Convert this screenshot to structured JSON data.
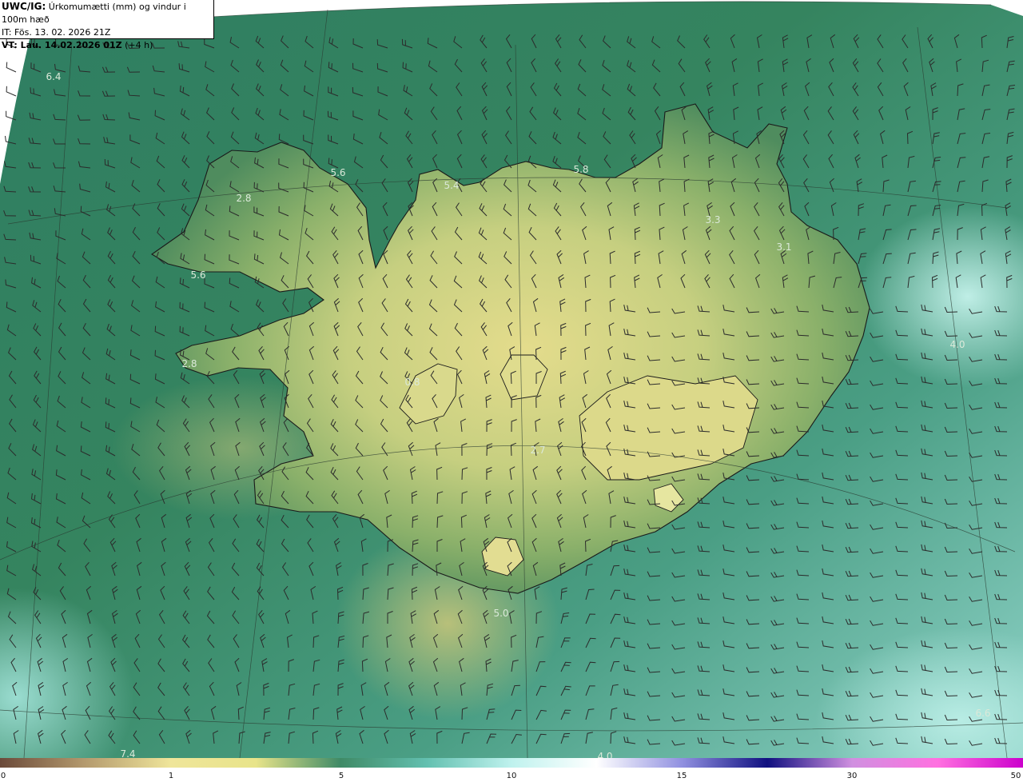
{
  "header": {
    "title_code": "UWC/IG:",
    "title_text": " Úrkomumætti (mm) og vindur i 100m hæð",
    "issue_time": "IT: Fös. 13. 02. 2026 21Z",
    "valid_label": "VT: Lau. 14.02.2026 01Z",
    "valid_suffix": " (+4 h)"
  },
  "colorbar": {
    "ticks": [
      "0",
      "1",
      "5",
      "10",
      "15",
      "30",
      "50"
    ],
    "colors": [
      "#6b4a3a",
      "#b49a6e",
      "#efe59a",
      "#e8e48a",
      "#3f8a66",
      "#63c0b0",
      "#bff2ee",
      "#ffffff",
      "#9090e0",
      "#101080",
      "#d090e0",
      "#ff70e0",
      "#cc00cc"
    ]
  },
  "map_values": [
    "6.4",
    "5.6",
    "2.8",
    "5.4",
    "5.8",
    "3.3",
    "3.1",
    "5.6",
    "2.8",
    "0.8",
    "2.7",
    "4.0",
    "5.0",
    "6.6",
    "7.4",
    "4.0"
  ],
  "colors": {
    "ocean_dark": "#2e7a5c",
    "ocean_teal": "#6cc0b0",
    "land_low": "#5e9c5e",
    "land_high": "#d8dc8a",
    "coast": "#1a1a1a"
  }
}
